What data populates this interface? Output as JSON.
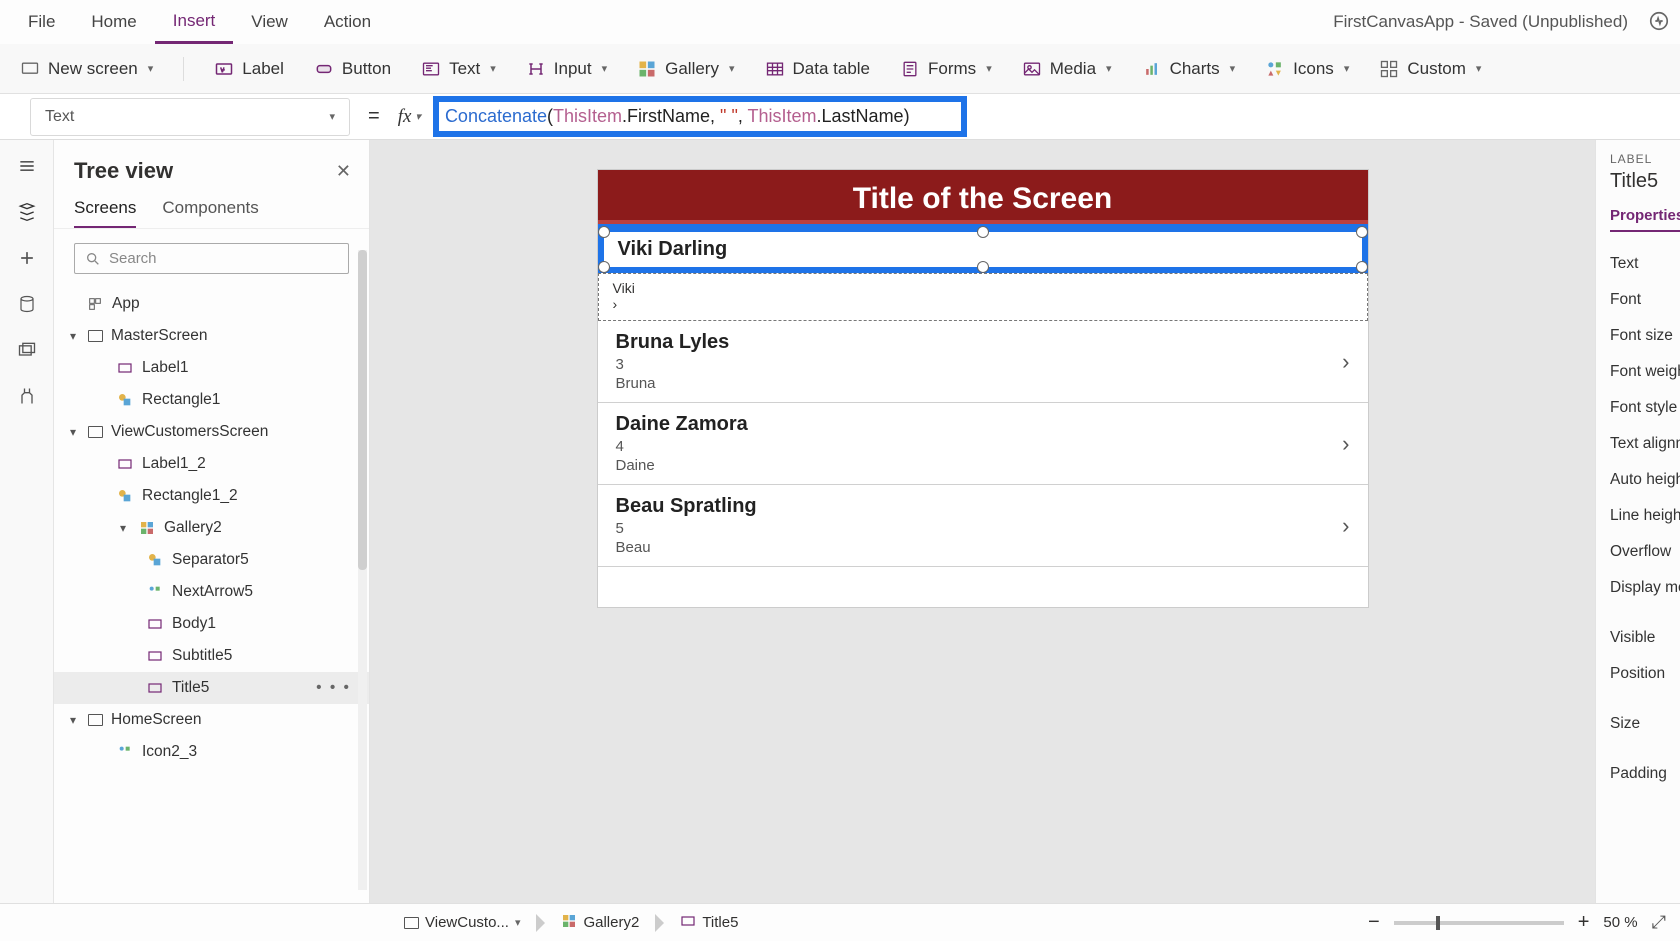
{
  "menu": {
    "file": "File",
    "home": "Home",
    "insert": "Insert",
    "view": "View",
    "action": "Action"
  },
  "app_status": "FirstCanvasApp - Saved (Unpublished)",
  "ribbon": {
    "new_screen": "New screen",
    "label": "Label",
    "button": "Button",
    "text": "Text",
    "input": "Input",
    "gallery": "Gallery",
    "data_table": "Data table",
    "forms": "Forms",
    "media": "Media",
    "charts": "Charts",
    "icons": "Icons",
    "custom": "Custom"
  },
  "property_select": "Text",
  "formula": {
    "fn": "Concatenate",
    "open": "(",
    "obj1": "ThisItem",
    "dot1": ".FirstName, ",
    "str": "\" \"",
    "comma": ", ",
    "obj2": "ThisItem",
    "dot2": ".LastName",
    "close": ")"
  },
  "tree": {
    "title": "Tree view",
    "tab_screens": "Screens",
    "tab_components": "Components",
    "search_placeholder": "Search",
    "nodes": {
      "app": "App",
      "master": "MasterScreen",
      "label1": "Label1",
      "rect1": "Rectangle1",
      "view": "ViewCustomersScreen",
      "label1_2": "Label1_2",
      "rect1_2": "Rectangle1_2",
      "gallery2": "Gallery2",
      "sep5": "Separator5",
      "next5": "NextArrow5",
      "body1": "Body1",
      "subtitle5": "Subtitle5",
      "title5": "Title5",
      "home": "HomeScreen",
      "icon2_3": "Icon2_3"
    }
  },
  "canvas": {
    "screen_title": "Title of the Screen",
    "items": [
      {
        "title": "Viki  Darling",
        "sub": "",
        "body": "Viki"
      },
      {
        "title": "Bruna  Lyles",
        "sub": "3",
        "body": "Bruna"
      },
      {
        "title": "Daine  Zamora",
        "sub": "4",
        "body": "Daine"
      },
      {
        "title": "Beau  Spratling",
        "sub": "5",
        "body": "Beau"
      }
    ]
  },
  "props": {
    "type": "LABEL",
    "name": "Title5",
    "tab": "Properties",
    "rows": [
      "Text",
      "Font",
      "Font size",
      "Font weight",
      "Font style",
      "Text alignme",
      "Auto height",
      "Line height",
      "Overflow",
      "Display mod",
      "Visible",
      "Position",
      "Size",
      "Padding"
    ]
  },
  "breadcrumbs": {
    "screen": "ViewCusto...",
    "gallery": "Gallery2",
    "title": "Title5"
  },
  "zoom": {
    "value": "50",
    "pct": "%"
  }
}
